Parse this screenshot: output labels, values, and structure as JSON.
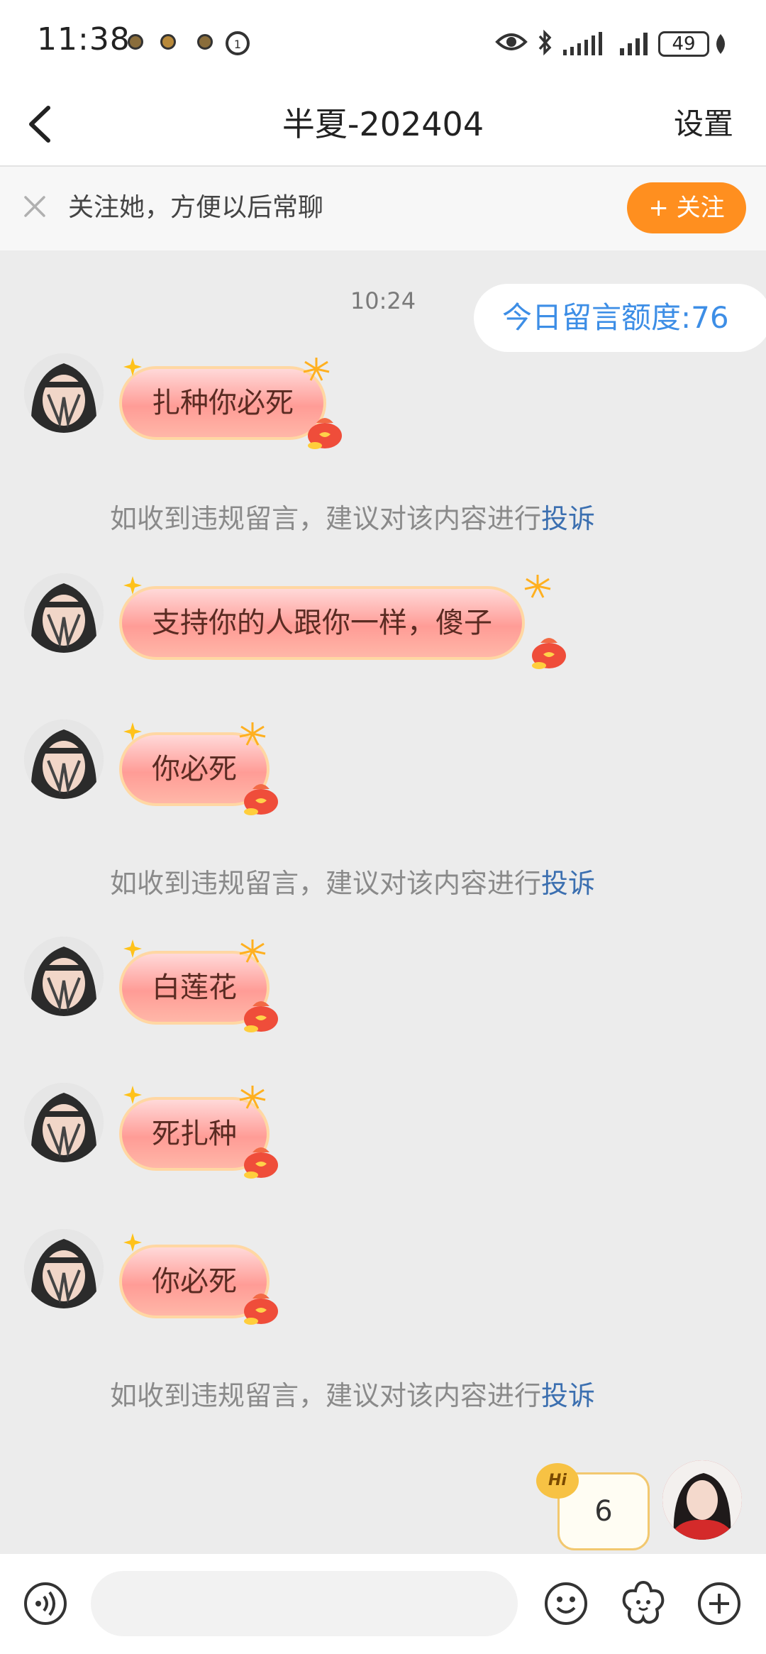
{
  "status_bar": {
    "time": "11:38",
    "battery": "49"
  },
  "header": {
    "title": "半夏-202404",
    "settings": "设置"
  },
  "follow_banner": {
    "text": "关注她，方便以后常聊",
    "button": "+ 关注"
  },
  "conversation": {
    "time": "10:24",
    "quota": "今日留言额度:76",
    "notice_text": "如收到违规留言，建议对该内容进行",
    "notice_link": "投诉",
    "messages": [
      {
        "text": "扎种你必死"
      },
      {
        "text": "支持你的人跟你一样，傻子"
      },
      {
        "text": "你必死"
      },
      {
        "text": "白莲花"
      },
      {
        "text": "死扎种"
      },
      {
        "text": "你必死"
      }
    ]
  },
  "hi_badge": {
    "tag": "Hi",
    "count": "6"
  },
  "input": {
    "placeholder": ""
  },
  "colors": {
    "accent_orange": "#ff8f1f",
    "link_blue": "#3b6fb0",
    "quota_blue": "#3d8ee6",
    "bubble_pink": "#ff9c96"
  }
}
